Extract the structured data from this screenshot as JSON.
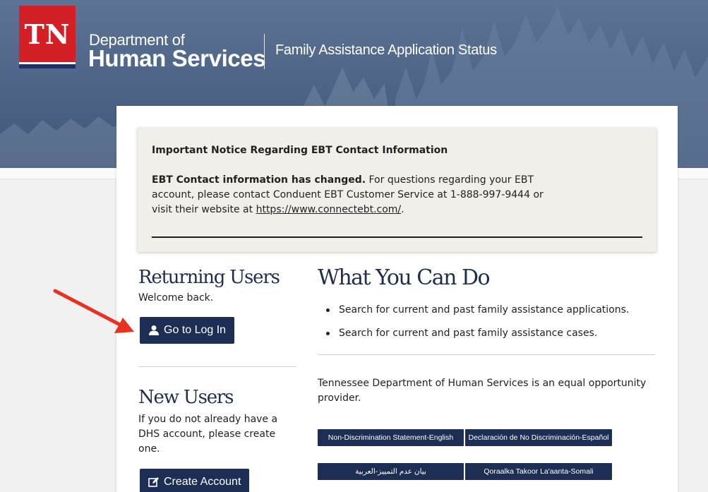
{
  "header": {
    "logo_text": "TN",
    "dept_line1": "Department of",
    "dept_line2": "Human Services",
    "app_title": "Family Assistance Application Status"
  },
  "notice": {
    "title": "Important Notice Regarding EBT Contact Information",
    "bold_lead": "EBT Contact information has changed.",
    "body_1": " For questions regarding your EBT account, please contact Conduent EBT Customer Service at 1-888-997-9444 or visit their website at ",
    "link": "https://www.connectebt.com/",
    "body_end": "."
  },
  "returning": {
    "heading": "Returning Users",
    "subtitle": "Welcome back.",
    "login_label": "Go to Log In",
    "login_icon": "user-icon"
  },
  "new_users": {
    "heading": "New Users",
    "text": "If you do not already have a DHS account, please create one.",
    "create_label": "Create Account",
    "create_icon": "edit-icon"
  },
  "what_you_can_do": {
    "heading": "What You Can Do",
    "items": [
      "Search for current and past family assistance applications.",
      "Search for current and past family assistance cases."
    ]
  },
  "equal_opportunity": "Tennessee Department of Human Services is an equal opportunity provider.",
  "language_buttons": [
    "Non-Discrimination Statement-English",
    "Declaración de No Discriminación-Español",
    "بيان عدم التمييز-العربية",
    "Qoraalka Takoor La'aanta-Somali"
  ],
  "colors": {
    "navy": "#1d2e55",
    "tn_red": "#d51f27",
    "hero_blue": "#4f6688",
    "arrow_red": "#e8321f"
  }
}
